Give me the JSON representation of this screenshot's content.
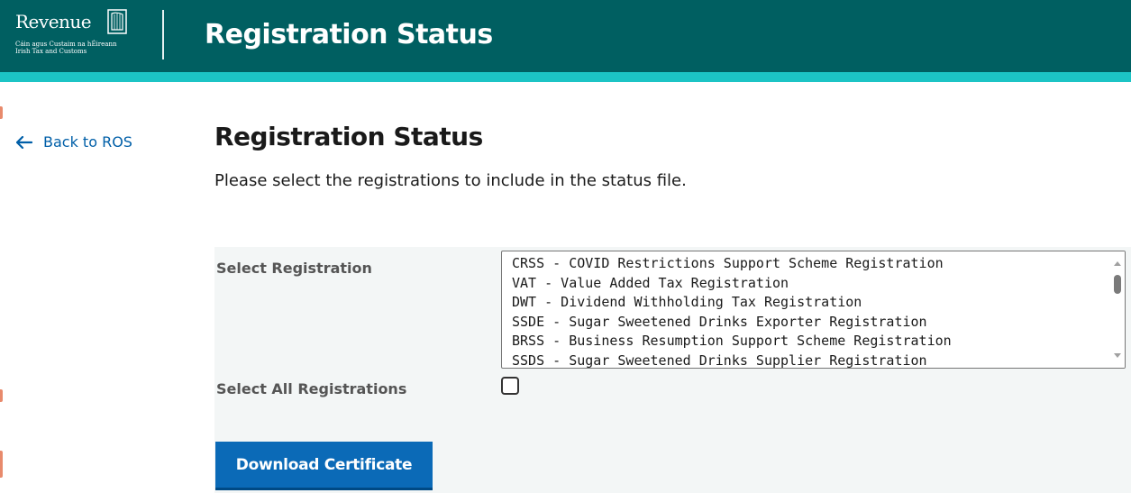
{
  "header": {
    "logo": {
      "wordmark": "Revenue",
      "subtitle_irish": "Cáin agus Custaim na hÉireann",
      "subtitle_english": "Irish Tax and Customs",
      "icon": "harp-icon"
    },
    "title": "Registration Status"
  },
  "nav": {
    "back_label": "Back to ROS",
    "back_icon": "arrow-left-icon"
  },
  "main": {
    "heading": "Registration Status",
    "instructions": "Please select the registrations to include in the status file."
  },
  "form": {
    "select_label": "Select Registration",
    "registrations": [
      "CRSS - COVID Restrictions Support Scheme Registration",
      "VAT - Value Added Tax Registration",
      "DWT - Dividend Withholding Tax Registration",
      "SSDE - Sugar Sweetened Drinks Exporter Registration",
      "BRSS - Business Resumption Support Scheme Registration",
      "SSDS - Sugar Sweetened Drinks Supplier Registration"
    ],
    "select_all_label": "Select All Registrations",
    "select_all_checked": false,
    "download_label": "Download Certificate"
  },
  "colors": {
    "header_bg": "#005f61",
    "header_stripe": "#1cc4c5",
    "link": "#005fa8",
    "button_bg": "#0b6ab7",
    "panel_bg": "#f3f6f6"
  }
}
